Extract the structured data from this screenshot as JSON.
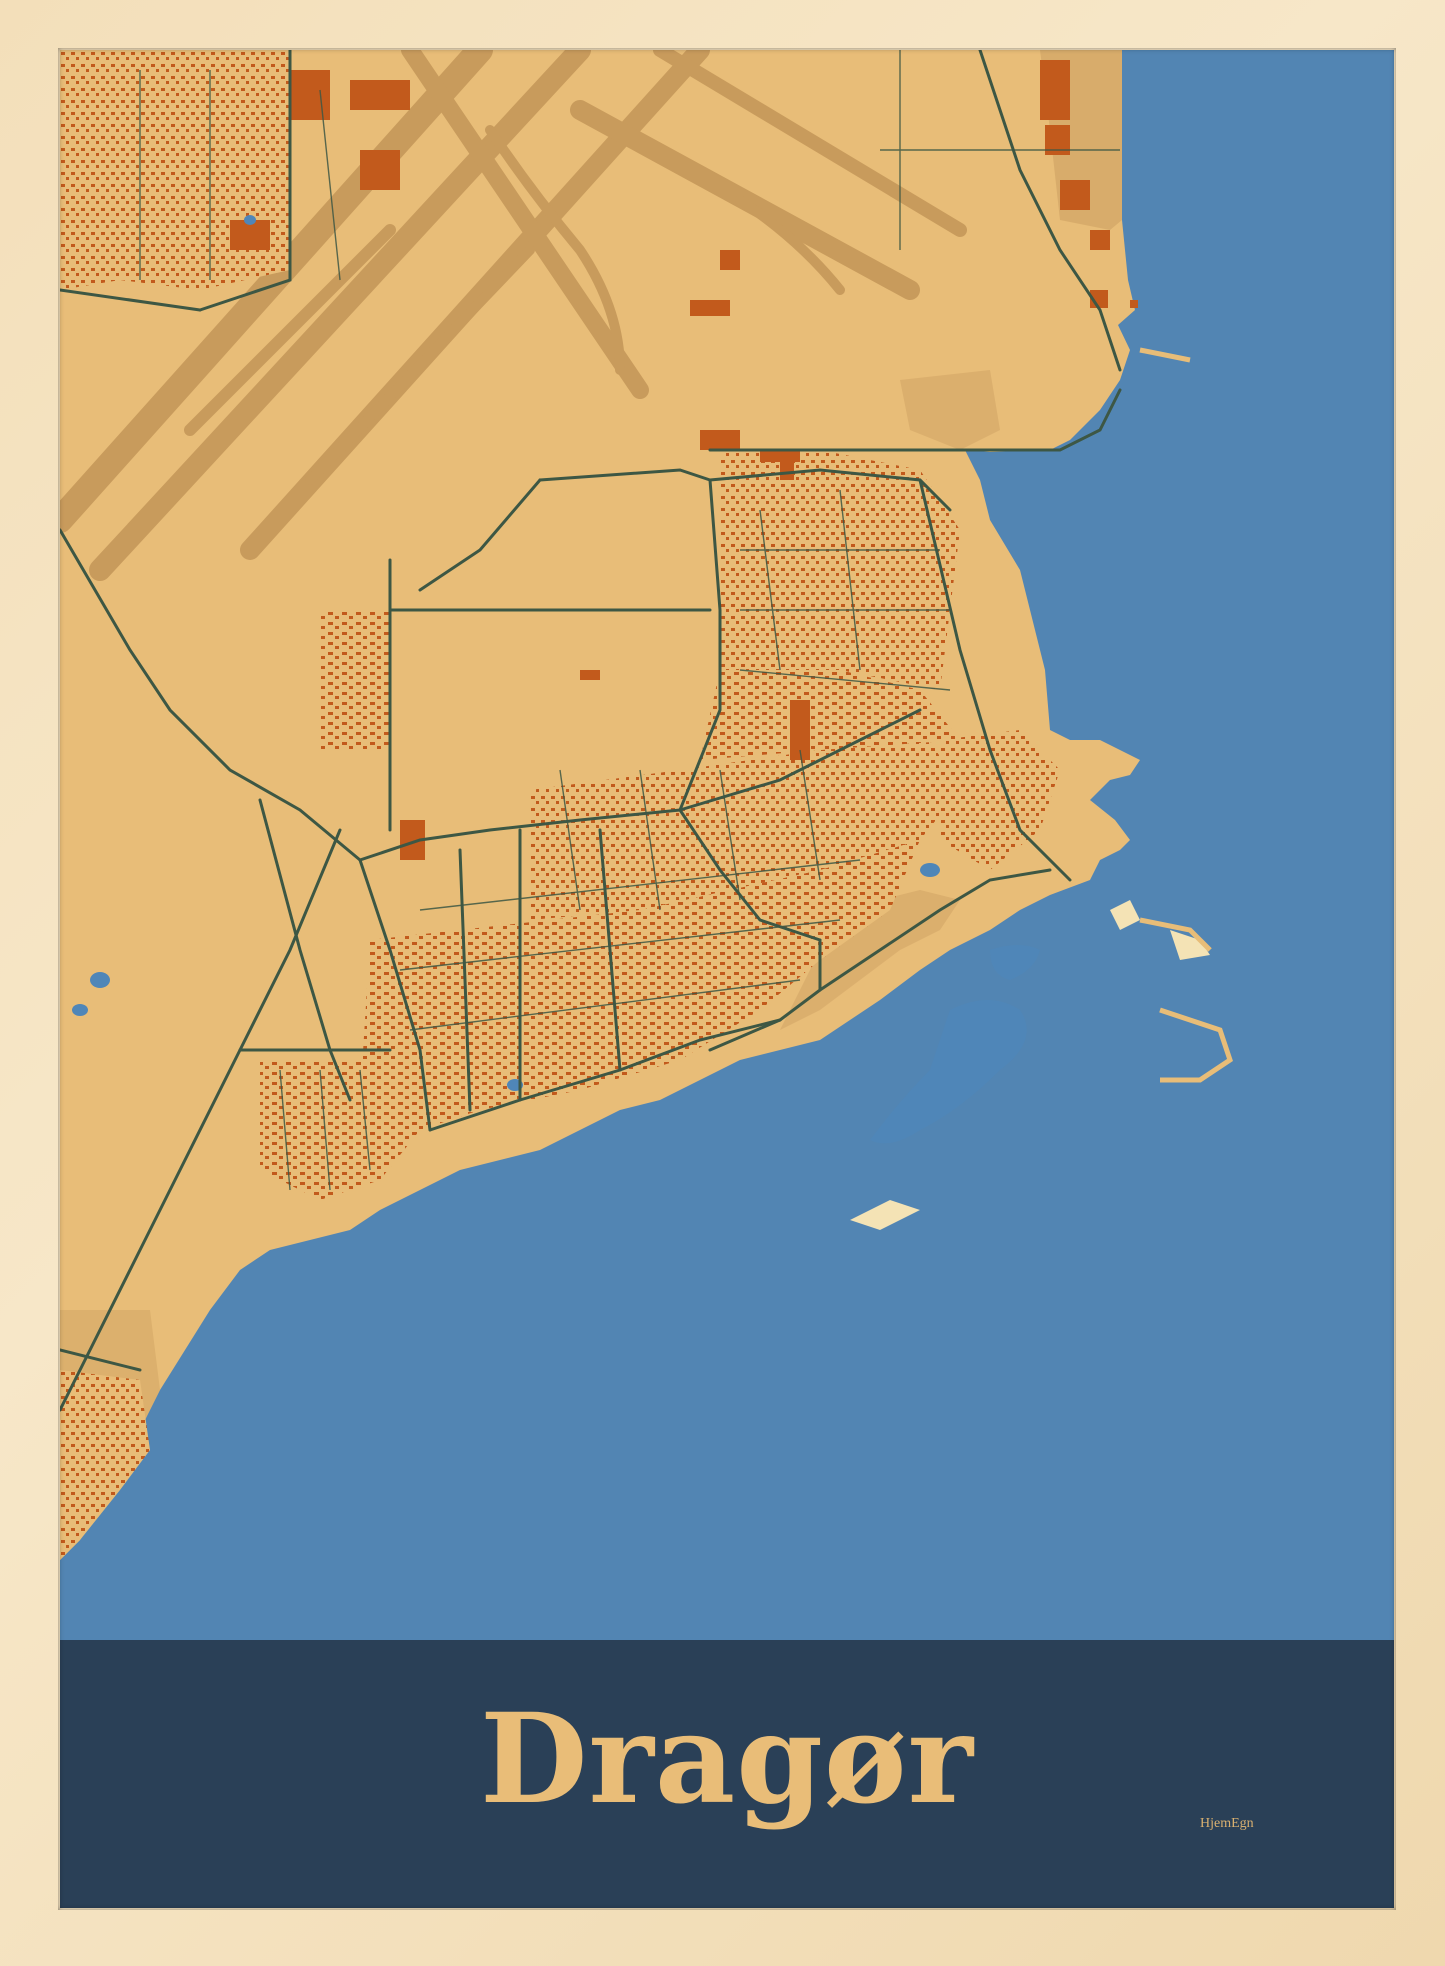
{
  "poster": {
    "city_name": "Dragør",
    "brand": "HjemEgn"
  },
  "colors": {
    "frame": "#f3dfba",
    "sea": "#5285b3",
    "land": "#e8bd78",
    "land_dark": "#d2a565",
    "runway": "#c89b5c",
    "building": "#c25a1c",
    "road": "#3d5744",
    "title_band": "#2a4057",
    "title_text": "#e9bd78",
    "lake": "#4f86b8",
    "beach": "#f4e3b5"
  },
  "map": {
    "feature_types": [
      "sea",
      "land",
      "airport-runways",
      "roads",
      "buildings",
      "lakes",
      "harbour",
      "beach"
    ]
  }
}
